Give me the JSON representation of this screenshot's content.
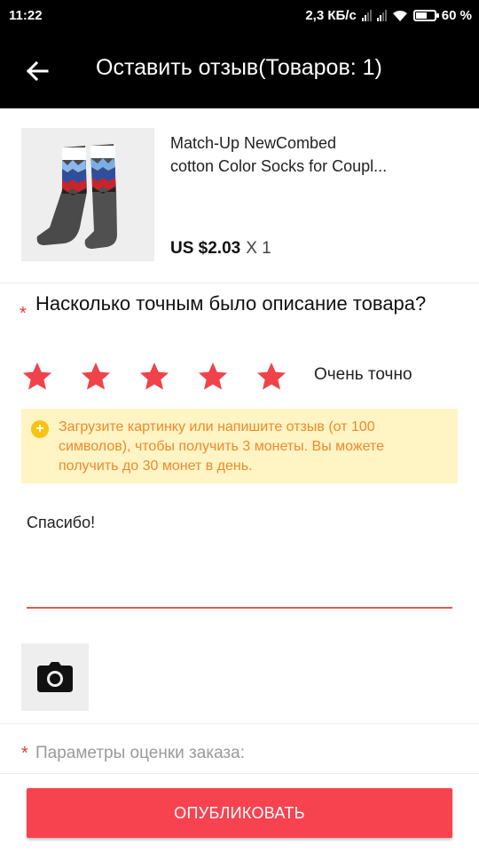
{
  "status_bar": {
    "time": "11:22",
    "network_speed": "2,3 КБ/с",
    "battery": "60 %",
    "battery_level": 0.6
  },
  "header": {
    "title": "Оставить отзыв(Товаров: 1)",
    "back_icon": "arrow-left-icon"
  },
  "product": {
    "name_line1": "Match-Up NewCombed",
    "name_line2": "cotton  Color Socks for Coupl...",
    "price": "US $2.03",
    "quantity": "X 1",
    "image": "socks-image"
  },
  "rating": {
    "required_mark": "*",
    "question": "Насколько точным было описание товара?",
    "stars_filled": 5,
    "stars_total": 5,
    "label": "Очень точно",
    "star_color": "#f0424b"
  },
  "notice": {
    "icon": "coin-icon",
    "icon_glyph": "+",
    "text": "Загрузите картинку или напишите отзыв (от 100 символов), чтобы получить 3 монеты. Вы можете получить до 30 монет в день."
  },
  "review": {
    "value": "Спасибо!"
  },
  "photo_button": {
    "icon": "camera-icon"
  },
  "order_params": {
    "required_mark": "*",
    "label": "Параметры оценки заказа:"
  },
  "publish_button": {
    "label": "ОПУБЛИКОВАТЬ",
    "color": "#f74350"
  }
}
